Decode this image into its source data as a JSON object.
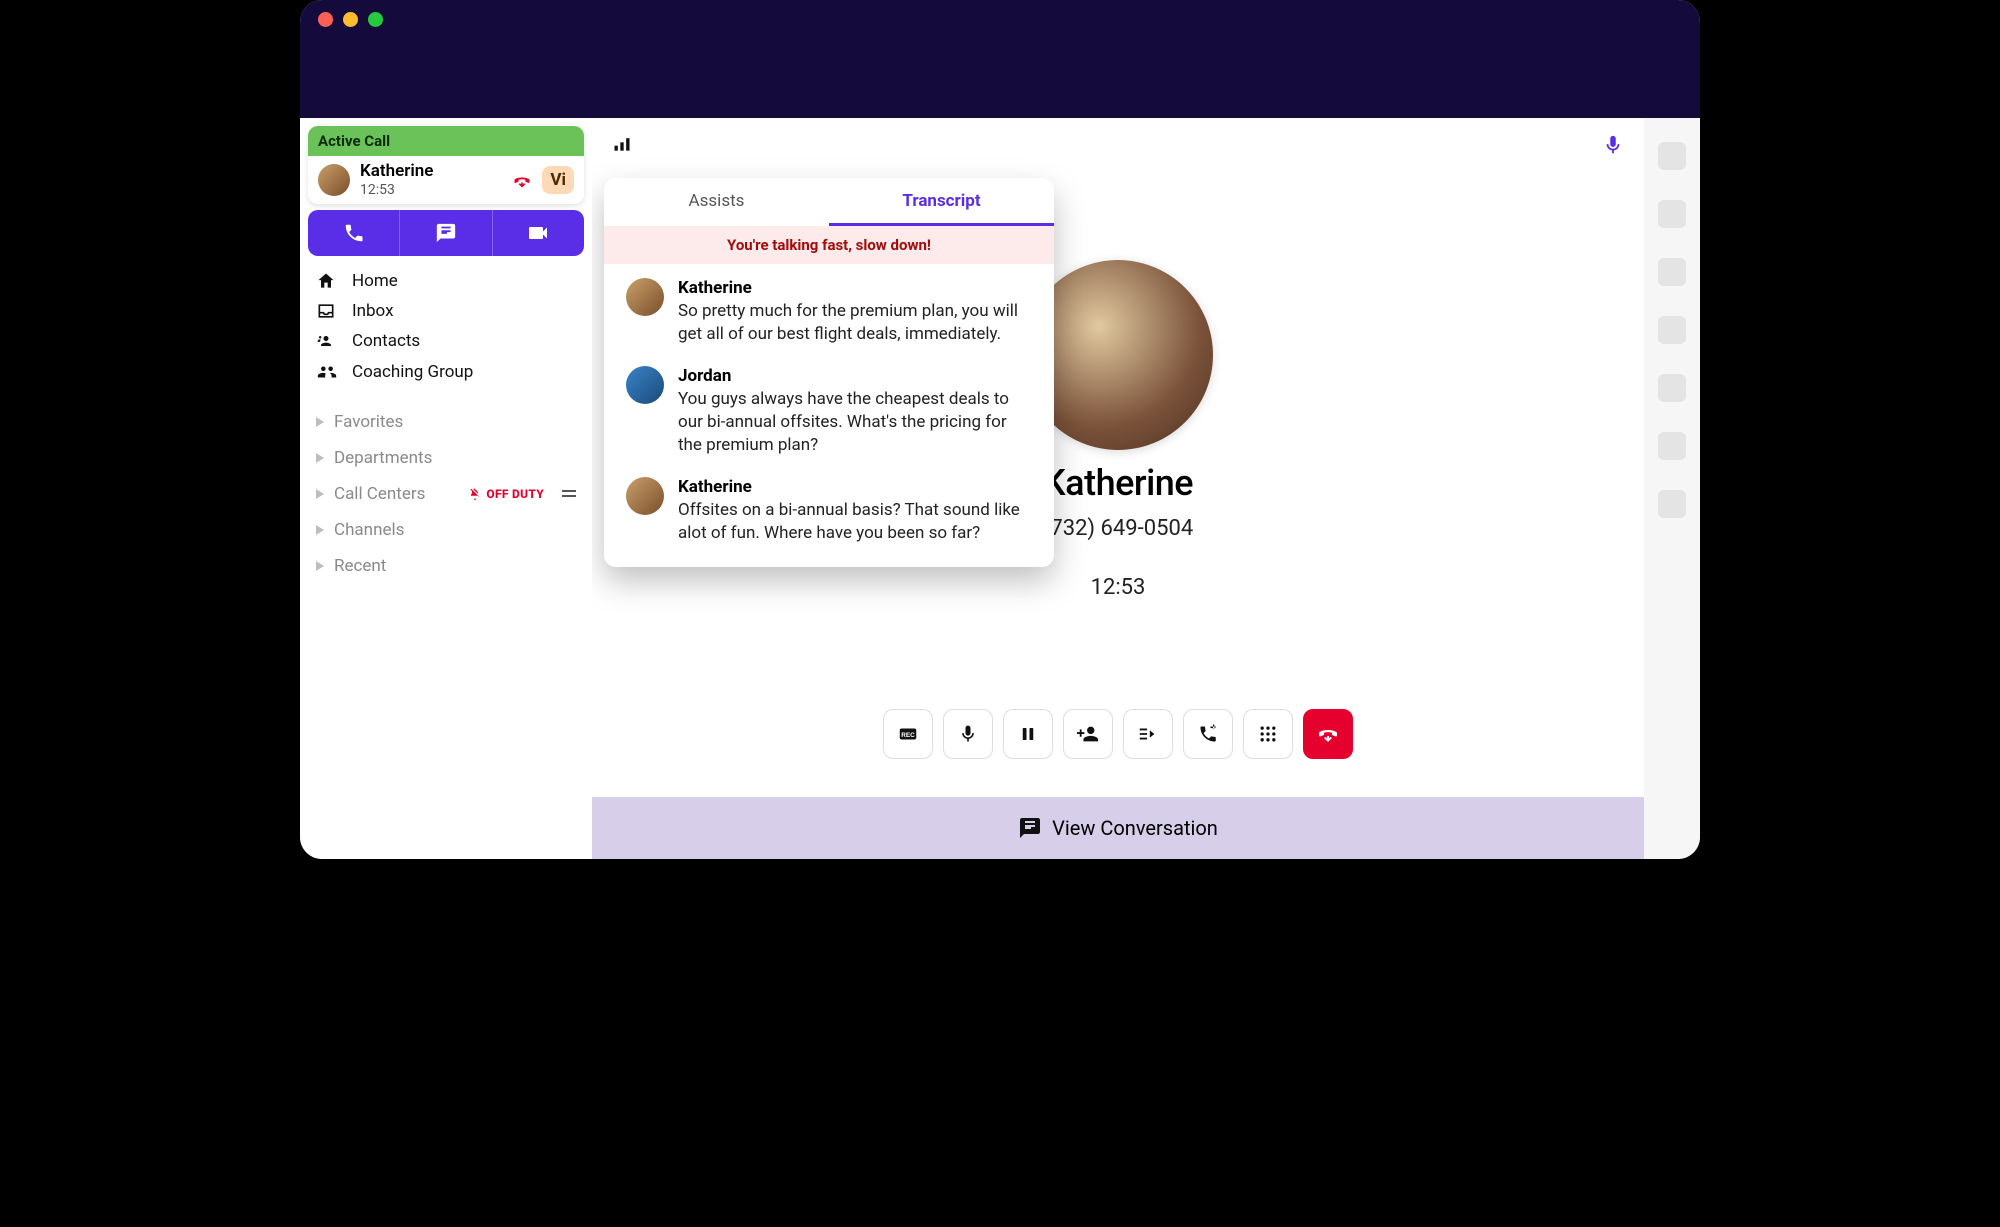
{
  "sidebar": {
    "active_call_header": "Active Call",
    "caller_name": "Katherine",
    "call_duration": "12:53",
    "vi_badge": "Vi",
    "nav": [
      {
        "icon": "home-icon",
        "label": "Home"
      },
      {
        "icon": "inbox-icon",
        "label": "Inbox"
      },
      {
        "icon": "contacts-icon",
        "label": "Contacts"
      },
      {
        "icon": "group-icon",
        "label": "Coaching Group"
      }
    ],
    "sections": [
      {
        "label": "Favorites"
      },
      {
        "label": "Departments"
      },
      {
        "label": "Call Centers",
        "off_duty": true,
        "off_duty_label": "OFF DUTY"
      },
      {
        "label": "Channels"
      },
      {
        "label": "Recent"
      }
    ]
  },
  "contact": {
    "name": "Katherine",
    "phone": "(732) 649-0504",
    "elapsed": "12:53",
    "partial_name": "herine",
    "partial_phone": "649-0504"
  },
  "popover": {
    "tabs": {
      "assists": "Assists",
      "transcript": "Transcript"
    },
    "banner": "You're talking fast, slow down!",
    "messages": [
      {
        "speaker": "Katherine",
        "avatar": "k",
        "text": "So pretty much for the premium plan, you will get all of our best flight deals, immediately."
      },
      {
        "speaker": "Jordan",
        "avatar": "j",
        "text": "You guys always have the cheapest deals to our bi-annual offsites. What's the pricing for the premium plan?"
      },
      {
        "speaker": "Katherine",
        "avatar": "k",
        "text": "Offsites on a bi-annual basis? That sound like alot of fun. Where have you been so far?"
      }
    ]
  },
  "footer": {
    "view_conversation": "View Conversation"
  }
}
